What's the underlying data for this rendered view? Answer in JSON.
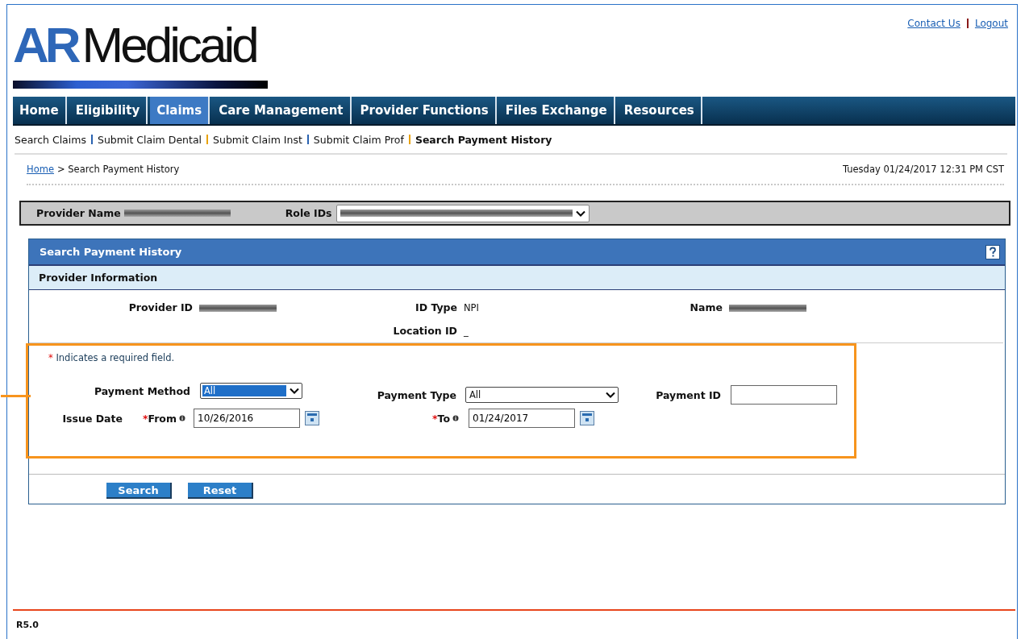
{
  "top_links": [
    {
      "label": "Contact Us"
    },
    {
      "label": "Logout"
    }
  ],
  "logo": {
    "accent": "AR",
    "text": "Medicaid"
  },
  "nav_tabs": [
    {
      "label": "Home",
      "selected": false
    },
    {
      "label": "Eligibility",
      "selected": false
    },
    {
      "label": "Claims",
      "selected": true
    },
    {
      "label": "Care Management",
      "selected": false
    },
    {
      "label": "Provider Functions",
      "selected": false
    },
    {
      "label": "Files Exchange",
      "selected": false
    },
    {
      "label": "Resources",
      "selected": false
    }
  ],
  "sub_nav": [
    {
      "label": "Search Claims",
      "selected": false
    },
    {
      "label": "Submit Claim Dental",
      "selected": false
    },
    {
      "label": "Submit Claim Inst",
      "selected": false
    },
    {
      "label": "Submit Claim Prof",
      "selected": false
    },
    {
      "label": "Search Payment History",
      "selected": true
    }
  ],
  "breadcrumb": {
    "link": "Home",
    "current": "> Search Payment History"
  },
  "datetime": "Tuesday 01/24/2017 12:31 PM CST",
  "provider_bar": {
    "name_label": "Provider Name",
    "role_label": "Role IDs"
  },
  "panel": {
    "title": "Search Payment History",
    "section": "Provider Information",
    "info": [
      {
        "label": "Provider ID"
      },
      {
        "label": "ID Type",
        "value": "NPI"
      },
      {
        "label": "Name"
      },
      {
        "label": "Location ID",
        "value": "_"
      }
    ]
  },
  "required_note": {
    "mark": "*",
    "text": "Indicates a required field."
  },
  "form": {
    "payment_method": {
      "label": "Payment Method",
      "value": "All"
    },
    "payment_type": {
      "label": "Payment Type",
      "value": "All"
    },
    "payment_id": {
      "label": "Payment ID"
    },
    "issue_date": {
      "label": "Issue Date"
    },
    "from": {
      "mark": "*",
      "label": "From",
      "value": "10/26/2016"
    },
    "to": {
      "mark": "*",
      "label": "To",
      "value": "01/24/2017"
    }
  },
  "buttons": [
    "Search",
    "Reset"
  ],
  "version": "R5.0"
}
